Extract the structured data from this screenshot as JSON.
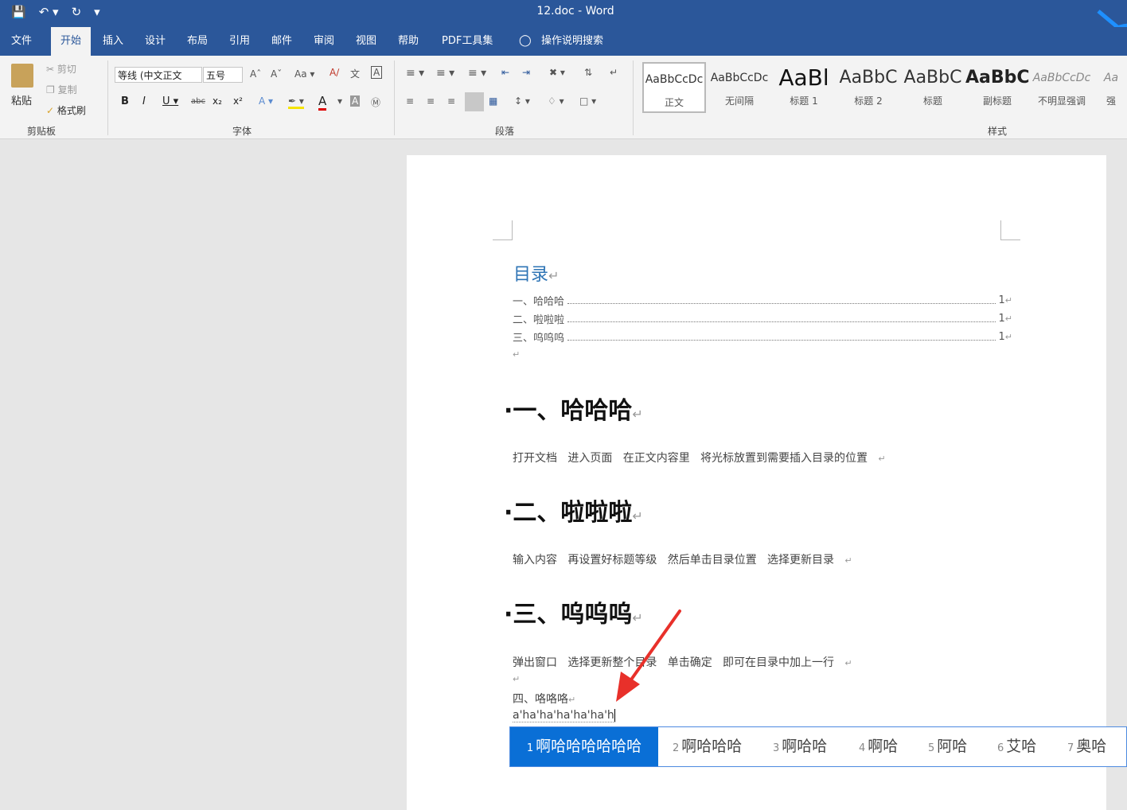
{
  "window": {
    "title": "12.doc  -  Word"
  },
  "tabs": [
    "文件",
    "开始",
    "插入",
    "设计",
    "布局",
    "引用",
    "邮件",
    "审阅",
    "视图",
    "帮助",
    "PDF工具集",
    "操作说明搜索"
  ],
  "clipboard": {
    "paste": "粘贴",
    "cut": "剪切",
    "copy": "复制",
    "format_painter": "格式刷",
    "label": "剪贴板"
  },
  "font": {
    "name": "等线 (中文正文",
    "size": "五号",
    "label": "字体"
  },
  "paragraph": {
    "label": "段落"
  },
  "styles": {
    "label": "样式",
    "items": [
      {
        "preview": "AaBbCcDc",
        "name": "正文"
      },
      {
        "preview": "AaBbCcDc",
        "name": "无间隔"
      },
      {
        "preview": "AaBl",
        "name": "标题 1"
      },
      {
        "preview": "AaBbC",
        "name": "标题 2"
      },
      {
        "preview": "AaBbC",
        "name": "标题"
      },
      {
        "preview": "AaBbC",
        "name": "副标题"
      },
      {
        "preview": "AaBbCcDc",
        "name": "不明显强调"
      },
      {
        "preview": "Aa",
        "name": "强"
      }
    ]
  },
  "document": {
    "toc_title": "目录",
    "toc": [
      {
        "text": "一、哈哈哈",
        "page": "1"
      },
      {
        "text": "二、啦啦啦",
        "page": "1"
      },
      {
        "text": "三、呜呜呜",
        "page": "1"
      }
    ],
    "h1": "一、哈哈哈",
    "p1": "打开文档   进入页面   在正文内容里   将光标放置到需要插入目录的位置",
    "h2": "二、啦啦啦",
    "p2": "输入内容   再设置好标题等级   然后单击目录位置   选择更新目录",
    "h3": "三、呜呜呜",
    "p3": "弹出窗口   选择更新整个目录   单击确定   即可在目录中加上一行",
    "line4": "四、咯咯咯",
    "typing": "a'ha'ha'ha'ha'ha'h"
  },
  "ime": {
    "candidates": [
      {
        "num": "1",
        "text": "啊哈哈哈哈哈哈"
      },
      {
        "num": "2",
        "text": "啊哈哈哈"
      },
      {
        "num": "3",
        "text": "啊哈哈"
      },
      {
        "num": "4",
        "text": "啊哈"
      },
      {
        "num": "5",
        "text": "阿哈"
      },
      {
        "num": "6",
        "text": "艾哈"
      },
      {
        "num": "7",
        "text": "奥哈"
      }
    ]
  },
  "colors": {
    "word_blue": "#2b579a",
    "heading_blue": "#2e74b5",
    "ime_selected": "#0a6fd6",
    "arrow": "#e8302a"
  }
}
